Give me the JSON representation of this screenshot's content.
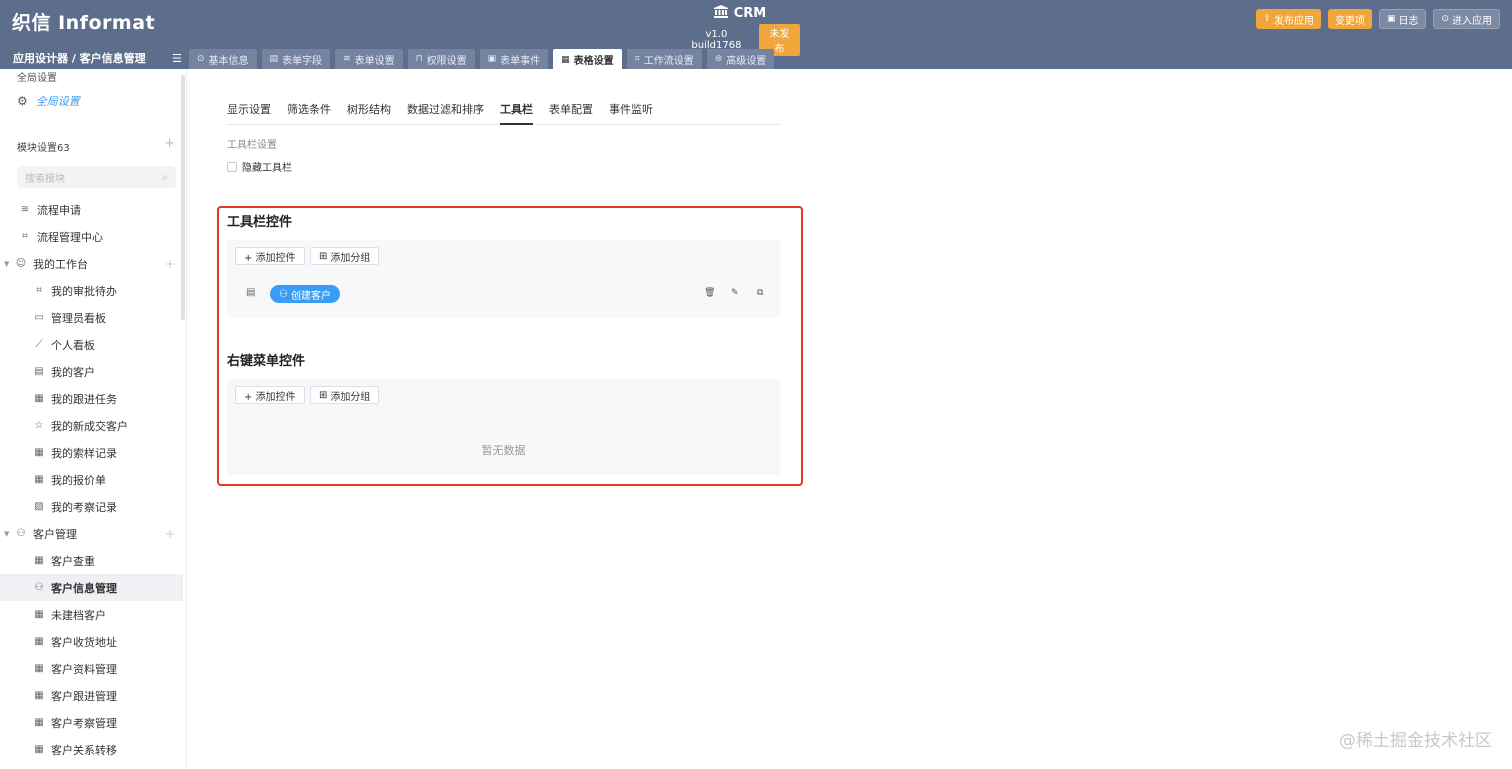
{
  "header": {
    "logo": "织信 Informat",
    "app_name": "CRM",
    "version": "v1.0 build1768",
    "status_badge": "未发布",
    "actions": [
      {
        "label": "发布应用",
        "icon": "upload-icon"
      },
      {
        "label": "变更项",
        "icon": ""
      },
      {
        "label": "日志",
        "icon": "log-icon"
      },
      {
        "label": "进入应用",
        "icon": "enter-icon"
      }
    ],
    "breadcrumb": "应用设计器 / 客户信息管理",
    "tabs": [
      {
        "label": "基本信息",
        "icon": "info-icon",
        "glyph": "⊙"
      },
      {
        "label": "表单字段",
        "icon": "fields-icon",
        "glyph": "▤"
      },
      {
        "label": "表单设置",
        "icon": "layers-icon",
        "glyph": "≋"
      },
      {
        "label": "权限设置",
        "icon": "lock-icon",
        "glyph": "⊓"
      },
      {
        "label": "表单事件",
        "icon": "event-icon",
        "glyph": "▣"
      },
      {
        "label": "表格设置",
        "icon": "table-icon",
        "glyph": "▦"
      },
      {
        "label": "工作流设置",
        "icon": "workflow-icon",
        "glyph": "⌗"
      },
      {
        "label": "高级设置",
        "icon": "database-icon",
        "glyph": "⊜"
      }
    ],
    "active_tab_index": 5
  },
  "sidebar": {
    "global_title": "全局设置",
    "global_item": "全局设置",
    "module_title": "模块设置63",
    "search_placeholder": "搜索模块",
    "items": [
      {
        "label": "流程申请",
        "level": 1,
        "icon": "layers-icon",
        "glyph": "≋"
      },
      {
        "label": "流程管理中心",
        "level": 1,
        "icon": "workflow-icon",
        "glyph": "⌗"
      },
      {
        "label": "我的工作台",
        "level": 0,
        "icon": "smile-icon",
        "glyph": "☺",
        "group": true
      },
      {
        "label": "我的审批待办",
        "level": 2,
        "icon": "workflow-icon",
        "glyph": "⌗"
      },
      {
        "label": "管理员看板",
        "level": 2,
        "icon": "board-icon",
        "glyph": "▭"
      },
      {
        "label": "个人看板",
        "level": 2,
        "icon": "chart-icon",
        "glyph": "⟋"
      },
      {
        "label": "我的客户",
        "level": 2,
        "icon": "form-icon",
        "glyph": "▤"
      },
      {
        "label": "我的跟进任务",
        "level": 2,
        "icon": "table-icon",
        "glyph": "▦"
      },
      {
        "label": "我的新成交客户",
        "level": 2,
        "icon": "star-icon",
        "glyph": "☆"
      },
      {
        "label": "我的索样记录",
        "level": 2,
        "icon": "table-icon",
        "glyph": "▦"
      },
      {
        "label": "我的报价单",
        "level": 2,
        "icon": "table-icon",
        "glyph": "▦"
      },
      {
        "label": "我的考察记录",
        "level": 2,
        "icon": "image-icon",
        "glyph": "▨"
      },
      {
        "label": "客户管理",
        "level": 0,
        "icon": "user-icon",
        "glyph": "⚇",
        "group": true
      },
      {
        "label": "客户查重",
        "level": 2,
        "icon": "table-icon",
        "glyph": "▦"
      },
      {
        "label": "客户信息管理",
        "level": 2,
        "icon": "user-icon",
        "glyph": "⚇",
        "selected": true
      },
      {
        "label": "未建档客户",
        "level": 2,
        "icon": "table-icon",
        "glyph": "▦"
      },
      {
        "label": "客户收货地址",
        "level": 2,
        "icon": "table-icon",
        "glyph": "▦"
      },
      {
        "label": "客户资料管理",
        "level": 2,
        "icon": "table-icon",
        "glyph": "▦"
      },
      {
        "label": "客户跟进管理",
        "level": 2,
        "icon": "table-icon",
        "glyph": "▦"
      },
      {
        "label": "客户考察管理",
        "level": 2,
        "icon": "table-icon",
        "glyph": "▦"
      },
      {
        "label": "客户关系转移",
        "level": 2,
        "icon": "table-icon",
        "glyph": "▦"
      }
    ]
  },
  "main": {
    "subtabs": [
      "显示设置",
      "筛选条件",
      "树形结构",
      "数据过滤和排序",
      "工具栏",
      "表单配置",
      "事件监听"
    ],
    "active_subtab_index": 4,
    "toolbar_settings_title": "工具栏设置",
    "hide_toolbar_label": "隐藏工具栏",
    "toolbar_controls": {
      "title": "工具栏控件",
      "add_control": "+ 添加控件",
      "add_group": "添加分组",
      "controls": [
        {
          "label": "创建客户"
        }
      ]
    },
    "context_menu": {
      "title": "右键菜单控件",
      "add_control": "+ 添加控件",
      "add_group": "添加分组",
      "empty_text": "暂无数据"
    }
  },
  "watermark": "@稀土掘金技术社区",
  "colors": {
    "header_bg": "#5d6e8c",
    "accent_orange": "#f0a63a",
    "accent_blue": "#3a9df5",
    "highlight_red": "#e0392b"
  }
}
